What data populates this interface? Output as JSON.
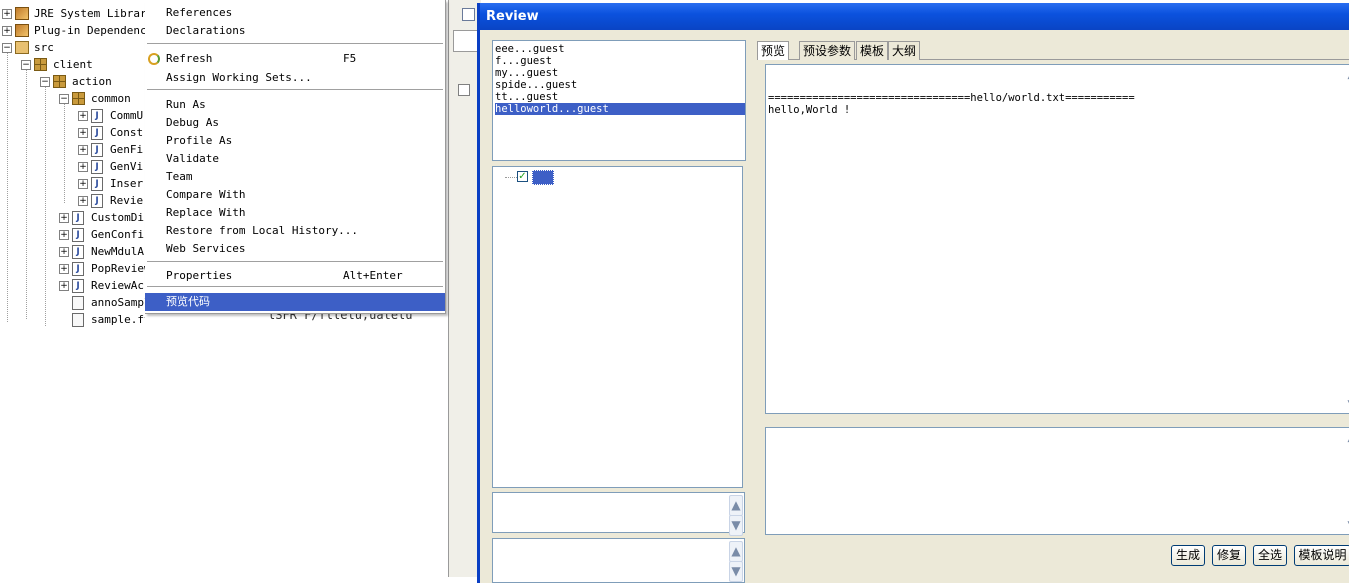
{
  "tree": {
    "items": [
      {
        "label": "JRE System Library",
        "toggle": "+",
        "icon": "library-icon"
      },
      {
        "label": "Plug-in Dependenci",
        "toggle": "+",
        "icon": "library-icon"
      },
      {
        "label": "src",
        "toggle": "−",
        "icon": "source-folder-icon"
      },
      {
        "label": "client",
        "toggle": "−",
        "icon": "package-icon"
      },
      {
        "label": "action",
        "toggle": "−",
        "icon": "package-icon"
      },
      {
        "label": "common",
        "toggle": "−",
        "icon": "package-icon"
      },
      {
        "label": "CommU",
        "toggle": "+",
        "icon": "java-file-icon"
      },
      {
        "label": "Const",
        "toggle": "+",
        "icon": "java-file-icon"
      },
      {
        "label": "GenFi",
        "toggle": "+",
        "icon": "java-file-icon"
      },
      {
        "label": "GenVi",
        "toggle": "+",
        "icon": "java-file-icon"
      },
      {
        "label": "Inser",
        "toggle": "+",
        "icon": "java-file-icon"
      },
      {
        "label": "Revie",
        "toggle": "+",
        "icon": "java-file-icon"
      },
      {
        "label": "CustomDi",
        "toggle": "+",
        "icon": "java-file-icon"
      },
      {
        "label": "GenConfi",
        "toggle": "+",
        "icon": "java-file-icon"
      },
      {
        "label": "NewMdulA",
        "toggle": "+",
        "icon": "java-file-icon"
      },
      {
        "label": "PopReview",
        "toggle": "+",
        "icon": "java-file-icon"
      },
      {
        "label": "ReviewAc",
        "toggle": "+",
        "icon": "java-file-icon"
      },
      {
        "label": "annoSampl",
        "toggle": "",
        "icon": "template-file-icon"
      },
      {
        "label": "sample.ftl",
        "toggle": "",
        "icon": "template-file-icon"
      }
    ]
  },
  "background_editor": {
    "code_fragment": "lSFR  F/fllelu,uatelu"
  },
  "context_menu": {
    "items": [
      {
        "label": "References",
        "shortcut": ""
      },
      {
        "label": "Declarations",
        "shortcut": ""
      },
      {
        "label": "Refresh",
        "shortcut": "F5"
      },
      {
        "label": "Assign Working Sets...",
        "shortcut": ""
      },
      {
        "label": "Run As",
        "shortcut": ""
      },
      {
        "label": "Debug As",
        "shortcut": ""
      },
      {
        "label": "Profile As",
        "shortcut": ""
      },
      {
        "label": "Validate",
        "shortcut": ""
      },
      {
        "label": "Team",
        "shortcut": ""
      },
      {
        "label": "Compare With",
        "shortcut": ""
      },
      {
        "label": "Replace With",
        "shortcut": ""
      },
      {
        "label": "Restore from Local History...",
        "shortcut": ""
      },
      {
        "label": "Web Services",
        "shortcut": ""
      },
      {
        "label": "Properties",
        "shortcut": "Alt+Enter"
      },
      {
        "label": "预览代码",
        "shortcut": ""
      }
    ]
  },
  "dialog": {
    "title": "Review",
    "file_list": [
      {
        "label": "eee...guest",
        "selected": false
      },
      {
        "label": "f...guest",
        "selected": false
      },
      {
        "label": "my...guest",
        "selected": false
      },
      {
        "label": "spide...guest",
        "selected": false
      },
      {
        "label": "tt...guest",
        "selected": false
      },
      {
        "label": "helloworld...guest",
        "selected": true
      }
    ],
    "tabs": [
      {
        "label": "预览",
        "active": true
      },
      {
        "label": "预设参数",
        "active": false
      },
      {
        "label": "模板",
        "active": false
      },
      {
        "label": "大纲",
        "active": false
      }
    ],
    "preview_lines": [
      "================================hello/world.txt===========",
      "hello,World !"
    ],
    "buttons": {
      "generate": "生成",
      "modify": "修复",
      "select_all": "全选",
      "template_help": "模板说明"
    },
    "colors": {
      "title_bar": "#0b52de",
      "selection": "#3d5fc6",
      "dialog_bg": "#ece9d8"
    }
  }
}
